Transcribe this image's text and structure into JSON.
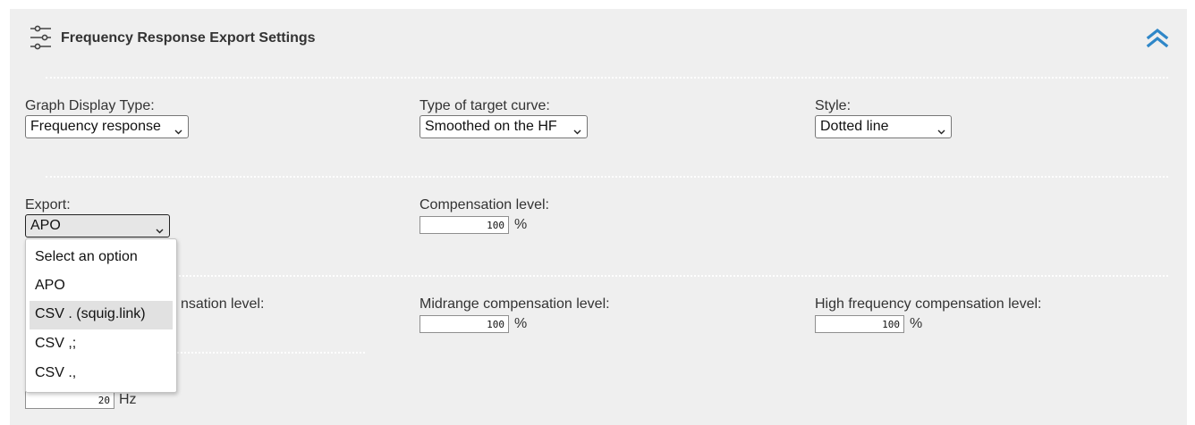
{
  "panel": {
    "title": "Frequency Response Export Settings",
    "header_icon": "sliders-icon",
    "collapse_icon": "double-chevron-up-icon",
    "accent_color": "#2f87c8"
  },
  "graph_display": {
    "label": "Graph Display Type:",
    "value": "Frequency response"
  },
  "target_curve": {
    "label": "Type of target curve:",
    "value": "Smoothed on the HF"
  },
  "style": {
    "label": "Style:",
    "value": "Dotted line"
  },
  "export": {
    "label": "Export:",
    "value": "APO",
    "options": [
      "Select an option",
      "APO",
      "CSV . (squig.link)",
      "CSV ,;",
      "CSV .,"
    ],
    "highlighted_index": 2
  },
  "compensation": {
    "label": "Compensation level:",
    "value": "100",
    "unit": "%"
  },
  "low_comp": {
    "label_visible_part": "nsation level:"
  },
  "mid_comp": {
    "label": "Midrange compensation level:",
    "value": "100",
    "unit": "%"
  },
  "high_comp": {
    "label": "High frequency compensation level:",
    "value": "100",
    "unit": "%"
  },
  "frequency": {
    "value": "20",
    "unit": "Hz"
  }
}
